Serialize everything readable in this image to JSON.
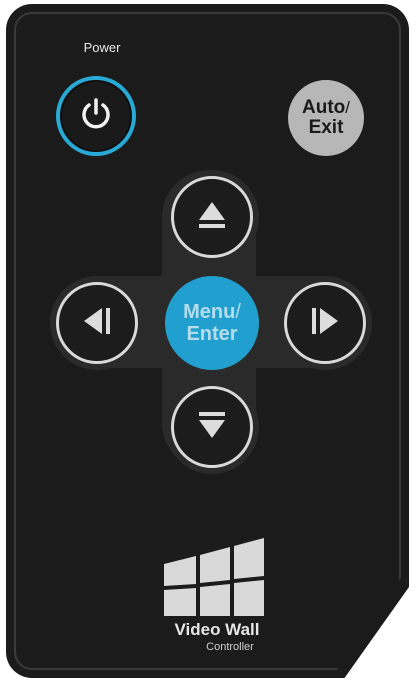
{
  "power": {
    "label": "Power",
    "icon": "power-icon",
    "ring_color": "#29a9d6"
  },
  "auto_exit": {
    "line1": "Auto",
    "slash": "/",
    "line2": "Exit",
    "color": "#b7b7b7"
  },
  "menu_enter": {
    "line1": "Menu",
    "slash": "/",
    "line2": "Enter",
    "color": "#21a6d7"
  },
  "arrows": {
    "up": "eject-up-icon",
    "down": "eject-down-icon",
    "left": "skip-left-icon",
    "right": "skip-right-icon"
  },
  "brand": {
    "title": "Video Wall",
    "subtitle": "Controller",
    "logo": "video-wall-grid-logo"
  },
  "colors": {
    "body": "#1b1b1c",
    "accent": "#21a6d7"
  }
}
